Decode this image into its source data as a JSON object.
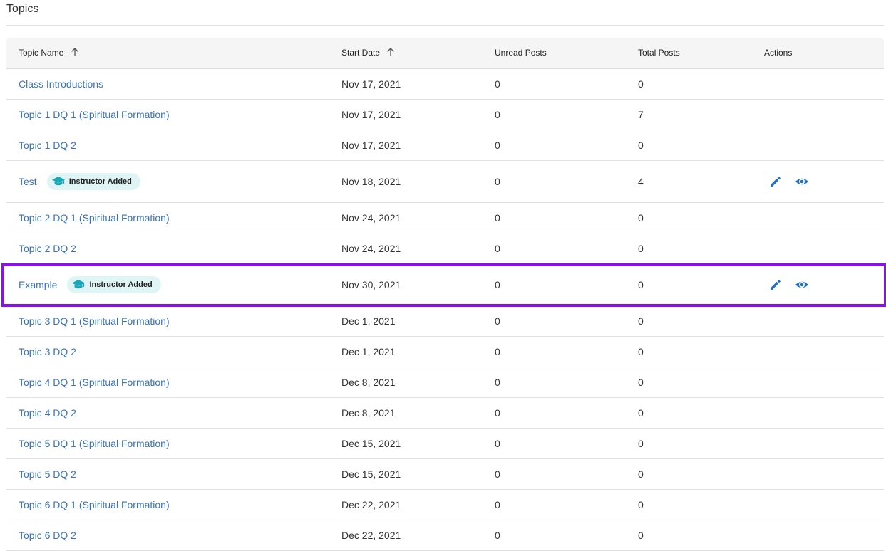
{
  "page": {
    "title": "Topics"
  },
  "table": {
    "columns": {
      "topic_name": "Topic Name",
      "start_date": "Start Date",
      "unread_posts": "Unread Posts",
      "total_posts": "Total Posts",
      "actions": "Actions"
    },
    "badge_label": "Instructor Added",
    "rows": [
      {
        "name": "Class Introductions",
        "date": "Nov 17, 2021",
        "unread": "0",
        "total": "0",
        "instructor_added": false
      },
      {
        "name": "Topic 1 DQ 1 (Spiritual Formation)",
        "date": "Nov 17, 2021",
        "unread": "0",
        "total": "7",
        "instructor_added": false
      },
      {
        "name": "Topic 1 DQ 2",
        "date": "Nov 17, 2021",
        "unread": "0",
        "total": "0",
        "instructor_added": false
      },
      {
        "name": "Test",
        "date": "Nov 18, 2021",
        "unread": "0",
        "total": "4",
        "instructor_added": true
      },
      {
        "name": "Topic 2 DQ 1 (Spiritual Formation)",
        "date": "Nov 24, 2021",
        "unread": "0",
        "total": "0",
        "instructor_added": false
      },
      {
        "name": "Topic 2 DQ 2",
        "date": "Nov 24, 2021",
        "unread": "0",
        "total": "0",
        "instructor_added": false
      },
      {
        "name": "Example",
        "date": "Nov 30, 2021",
        "unread": "0",
        "total": "0",
        "instructor_added": true,
        "highlighted": true
      },
      {
        "name": "Topic 3 DQ 1 (Spiritual Formation)",
        "date": "Dec 1, 2021",
        "unread": "0",
        "total": "0",
        "instructor_added": false
      },
      {
        "name": "Topic 3 DQ 2",
        "date": "Dec 1, 2021",
        "unread": "0",
        "total": "0",
        "instructor_added": false
      },
      {
        "name": "Topic 4 DQ 1 (Spiritual Formation)",
        "date": "Dec 8, 2021",
        "unread": "0",
        "total": "0",
        "instructor_added": false
      },
      {
        "name": "Topic 4 DQ 2",
        "date": "Dec 8, 2021",
        "unread": "0",
        "total": "0",
        "instructor_added": false
      },
      {
        "name": "Topic 5 DQ 1 (Spiritual Formation)",
        "date": "Dec 15, 2021",
        "unread": "0",
        "total": "0",
        "instructor_added": false
      },
      {
        "name": "Topic 5 DQ 2",
        "date": "Dec 15, 2021",
        "unread": "0",
        "total": "0",
        "instructor_added": false
      },
      {
        "name": "Topic 6 DQ 1 (Spiritual Formation)",
        "date": "Dec 22, 2021",
        "unread": "0",
        "total": "0",
        "instructor_added": false
      },
      {
        "name": "Topic 6 DQ 2",
        "date": "Dec 22, 2021",
        "unread": "0",
        "total": "0",
        "instructor_added": false
      }
    ]
  },
  "icons": {
    "sort": "arrow-up-icon",
    "badge": "graduation-cap-icon",
    "edit": "pencil-icon",
    "view": "eye-icon"
  },
  "colors": {
    "link": "#3a73b8",
    "badge_bg": "#dff4f5",
    "badge_icon": "#1aa6b7",
    "action_icon": "#1f6fc4",
    "highlight": "#8a11e8"
  }
}
